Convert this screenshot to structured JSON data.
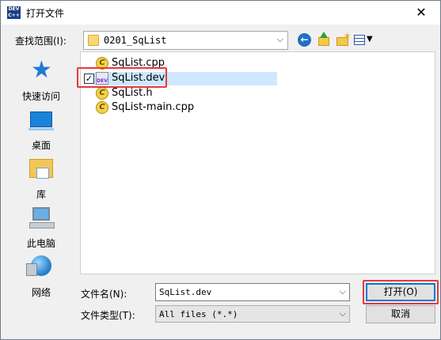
{
  "window": {
    "title": "打开文件",
    "app_icon_text": [
      "DEV",
      "C++"
    ],
    "close_glyph": "✕"
  },
  "toolbar": {
    "lookin_label": "查找范围(I):",
    "lookin_value": "0201_SqList",
    "icons": [
      "back-icon",
      "up-folder-icon",
      "new-folder-icon",
      "view-menu-icon"
    ]
  },
  "places": [
    {
      "label": "快速访问",
      "icon": "quick-access-star-icon"
    },
    {
      "label": "桌面",
      "icon": "desktop-icon"
    },
    {
      "label": "库",
      "icon": "library-icon"
    },
    {
      "label": "此电脑",
      "icon": "computer-icon"
    },
    {
      "label": "网络",
      "icon": "network-icon"
    }
  ],
  "files": [
    {
      "name": "SqList.cpp",
      "type": "cpp",
      "selected": false
    },
    {
      "name": "SqList.dev",
      "type": "dev",
      "selected": true,
      "checked": true
    },
    {
      "name": "SqList.h",
      "type": "h",
      "selected": false
    },
    {
      "name": "SqList-main.cpp",
      "type": "cpp",
      "selected": false
    }
  ],
  "form": {
    "filename_label": "文件名(N):",
    "filename_value": "SqList.dev",
    "filetype_label": "文件类型(T):",
    "filetype_value": "All files (*.*)"
  },
  "buttons": {
    "open": "打开(O)",
    "cancel": "取消"
  },
  "colors": {
    "selection": "#cde8ff",
    "highlight_box": "#e8373c",
    "default_button_border": "#0078d7"
  }
}
